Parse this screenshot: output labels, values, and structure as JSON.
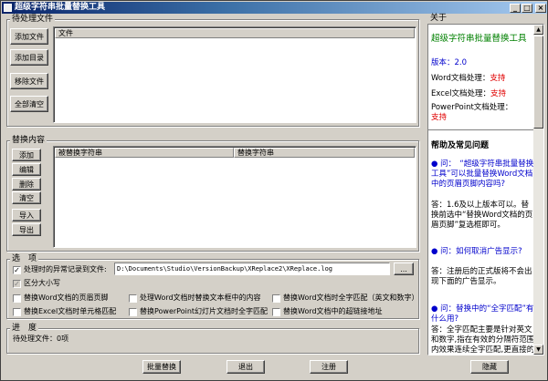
{
  "window": {
    "title": "超级字符串批量替换工具",
    "minimize": "_",
    "maximize": "□",
    "close": "×"
  },
  "pending": {
    "group_label": "待处理文件",
    "buttons": {
      "add_file": "添加文件",
      "add_dir": "添加目录",
      "remove_file": "移除文件",
      "clear_all": "全部清空"
    },
    "column": "文件"
  },
  "replace": {
    "group_label": "替换内容",
    "buttons": {
      "add": "添加",
      "edit": "编辑",
      "delete": "删除",
      "clear": "清空",
      "import": "导入",
      "export": "导出"
    },
    "columns": [
      "被替换字符串",
      "替换字符串"
    ]
  },
  "options": {
    "group_label": "选　项",
    "log_label": "处理时的异常记录到文件:",
    "log_path": "D:\\Documents\\Studio\\VersionBackup\\XReplace2\\XReplace.log",
    "browse": "...",
    "case_sensitive": "区分大小写",
    "word_header_footer": "替换Word文档的页眉页脚",
    "word_textbox": "处理Word文档时替换文本框中的内容",
    "word_full_match": "替换Word文档时全字匹配（英文和数字）",
    "excel_full_match": "替换Excel文档时单元格匹配",
    "ppt_full_match": "替换PowerPoint幻灯片文档时全字匹配",
    "word_hyperlink": "替换Word文档中的超链接地址"
  },
  "progress": {
    "group_label": "进　度",
    "status": "待处理文件：0项"
  },
  "actions": {
    "batch_replace": "批量替换",
    "exit": "退出",
    "register": "注册",
    "hide": "隐藏"
  },
  "about": {
    "group_label": "关于",
    "app_name": "超级字符串批量替换工具",
    "version": "版本：2.0",
    "word_label": "Word文档处理：",
    "word_value": "支持",
    "excel_label": "Excel文档处理：",
    "excel_value": "支持",
    "ppt_label": "PowerPoint文档处理：",
    "ppt_value": "支持"
  },
  "faq": {
    "heading": "帮助及常见问题",
    "items": [
      {
        "q": "问：　“超级字符串批量替换工具”可以批量替换Word文档中的页眉页脚内容吗?",
        "a": "答：1.6及以上版本可以。替换前选中“替换Word文档的页眉页脚”复选框即可。"
      },
      {
        "q": "问：如何取消广告显示?",
        "a": "答：注册后的正式版将不会出现下面的广告显示。"
      },
      {
        "q": "问：替换中的“全字匹配”有什么用?",
        "a": "答：全字匹配主要是针对英文和数字,指在有效的分隔符范围内效果连续全字匹配,更直接的"
      }
    ]
  }
}
